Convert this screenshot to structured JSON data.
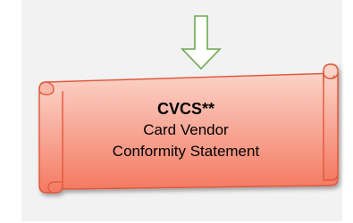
{
  "colors": {
    "panel_background": "#f2f2f2",
    "scroll_fill_top": "#fbd3c8",
    "scroll_fill_bottom": "#f47a62",
    "scroll_stroke": "#e0573b",
    "arrow_stroke": "#6aa84f",
    "arrow_fill": "#ffffff"
  },
  "arrow": {
    "icon": "down-arrow-icon"
  },
  "scroll": {
    "icon": "scroll-banner-icon",
    "title": "CVCS**",
    "line1": "Card Vendor",
    "line2": "Conformity Statement"
  }
}
